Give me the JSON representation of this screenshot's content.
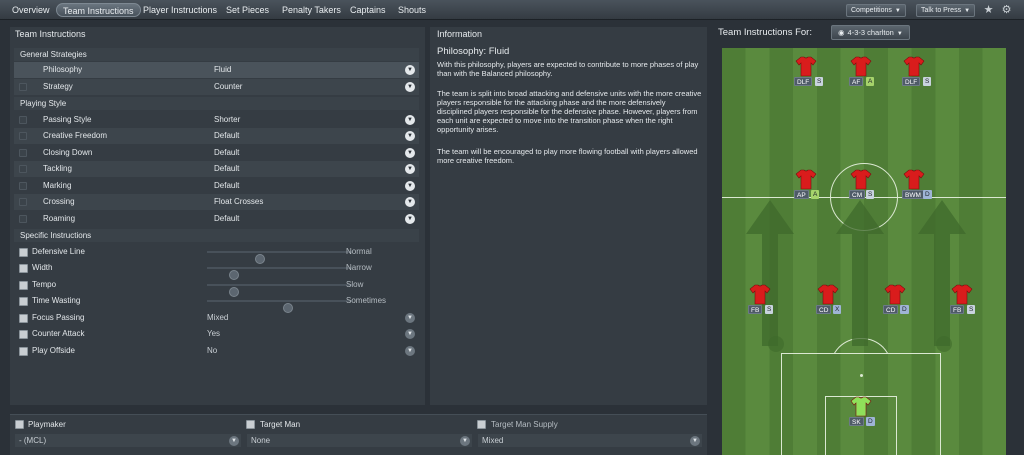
{
  "tabs": [
    {
      "label": "Overview"
    },
    {
      "label": "Team Instructions",
      "active": true
    },
    {
      "label": "Player Instructions"
    },
    {
      "label": "Set Pieces"
    },
    {
      "label": "Penalty Takers"
    },
    {
      "label": "Captains"
    },
    {
      "label": "Shouts"
    }
  ],
  "toolbar": {
    "competitions": "Competitions",
    "talk_to_press": "Talk to Press"
  },
  "left_panel": {
    "title": "Team Instructions",
    "general_header": "General Strategies",
    "general": [
      {
        "label": "Philosophy",
        "value": "Fluid"
      },
      {
        "label": "Strategy",
        "value": "Counter"
      }
    ],
    "playing_header": "Playing Style",
    "playing": [
      {
        "label": "Passing Style",
        "value": "Shorter"
      },
      {
        "label": "Creative Freedom",
        "value": "Default"
      },
      {
        "label": "Closing Down",
        "value": "Default"
      },
      {
        "label": "Tackling",
        "value": "Default"
      },
      {
        "label": "Marking",
        "value": "Default"
      },
      {
        "label": "Crossing",
        "value": "Float Crosses"
      },
      {
        "label": "Roaming",
        "value": "Default"
      }
    ],
    "specific_header": "Specific Instructions",
    "sliders": [
      {
        "label": "Defensive Line",
        "value": "Normal",
        "level": 0.45
      },
      {
        "label": "Width",
        "value": "Narrow",
        "level": 0.25
      },
      {
        "label": "Tempo",
        "value": "Slow",
        "level": 0.25
      },
      {
        "label": "Time Wasting",
        "value": "Sometimes",
        "level": 0.6
      }
    ],
    "selects": [
      {
        "label": "Focus Passing",
        "value": "Mixed"
      },
      {
        "label": "Counter Attack",
        "value": "Yes"
      },
      {
        "label": "Play Offside",
        "value": "No"
      }
    ]
  },
  "information": {
    "title": "Information",
    "heading": "Philosophy: Fluid",
    "p1": "With this philosophy, players are expected to contribute to more phases of play than with the Balanced philosophy.",
    "p2": "The team is split into broad attacking and defensive units with the more creative players responsible for the attacking phase and the more defensively disciplined players responsible for the defensive phase. However, players from each unit are expected to move into the transition phase when the right opportunity arises.",
    "p3": "The team will be encouraged to play more flowing football with players allowed more creative freedom."
  },
  "formation": {
    "header": "Team Instructions For:",
    "selected": "4-3-3 charlton",
    "players": {
      "dlf_left": {
        "role": "DLF",
        "duty": "S"
      },
      "af": {
        "role": "AF",
        "duty": "A"
      },
      "dlf_right": {
        "role": "DLF",
        "duty": "S"
      },
      "ap": {
        "role": "AP",
        "duty": "A"
      },
      "cm": {
        "role": "CM",
        "duty": "S"
      },
      "bwm": {
        "role": "BWM",
        "duty": "D"
      },
      "fb_left": {
        "role": "FB",
        "duty": "S"
      },
      "cd_left": {
        "role": "CD",
        "duty": "X"
      },
      "cd_right": {
        "role": "CD",
        "duty": "D"
      },
      "fb_right": {
        "role": "FB",
        "duty": "S"
      },
      "gk": {
        "role": "SK",
        "duty": "D"
      }
    }
  },
  "bottom": {
    "playmaker_label": "Playmaker",
    "playmaker_value": "- (MCL)",
    "target_man_label": "Target Man",
    "target_man_value": "None",
    "target_supply_label": "Target Man Supply",
    "target_supply_value": "Mixed"
  },
  "colors": {
    "shirt": "#d91c1c",
    "gk_shirt": "#8fe05a",
    "pitch": "#55843b"
  }
}
